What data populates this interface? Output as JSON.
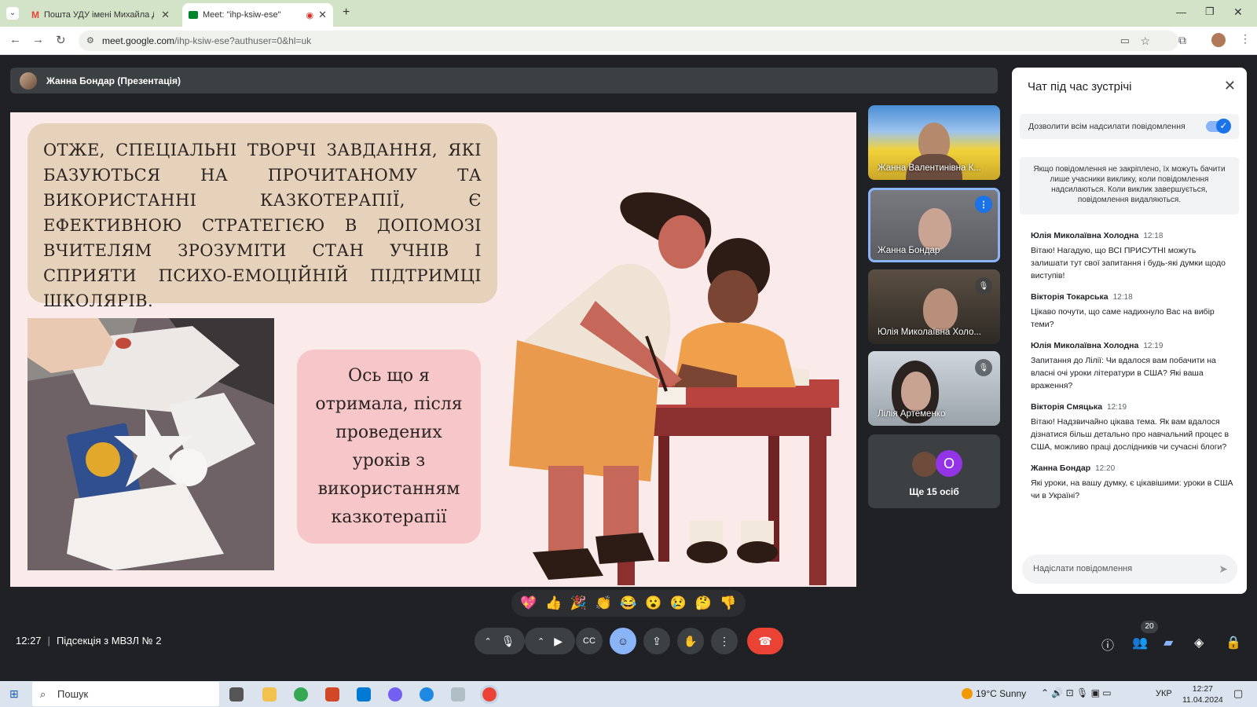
{
  "browser": {
    "tabs": [
      {
        "title": "Пошта УДУ імені Михайла Др",
        "icon": "gmail-icon"
      },
      {
        "title": "Meet: \"ihp-ksiw-ese\"",
        "icon": "meet-icon"
      }
    ],
    "url_host": "meet.google.com",
    "url_path": "/ihp-ksiw-ese?authuser=0&hl=uk"
  },
  "presenter": {
    "label": "Жанна Бондар (Презентація)"
  },
  "slide": {
    "main_text": "Отже, спеціальні творчі завдання, які базуються на прочитаному та використанні казкотерапії, є ефективною стратегією в допомозі вчителям зрозуміти стан учнів і сприяти психо-емоційній підтримці школярів.",
    "pink_text": "Ось що я отримала, після проведених уроків з використанням казкотерапії"
  },
  "tiles": [
    {
      "name": "Жанна Валентинівна К...",
      "state": "normal"
    },
    {
      "name": "Жанна Бондар",
      "state": "speaking"
    },
    {
      "name": "Юлія Миколаївна Холо...",
      "state": "muted"
    },
    {
      "name": "Лілія Артеменко",
      "state": "muted"
    }
  ],
  "more_tile": {
    "avatar_letter": "О",
    "label": "Ще 15 осіб"
  },
  "chat": {
    "title": "Чат під час зустрічі",
    "allow_label": "Дозволити всім надсилати повідомлення",
    "allow_enabled": true,
    "info": "Якщо повідомлення не закріплено, їх можуть бачити лише учасники виклику, коли повідомлення надсилаються. Коли виклик завершується, повідомлення видаляються.",
    "messages": [
      {
        "author": "Юлія Миколаївна Холодна",
        "time": "12:18",
        "text": "Вітаю! Нагадую, що ВСІ ПРИСУТНІ можуть залишати тут свої запитання і будь-які думки щодо виступів!"
      },
      {
        "author": "Вікторія Токарська",
        "time": "12:18",
        "text": "Цікаво почути, що саме надихнуло Вас на вибір теми?"
      },
      {
        "author": "Юлія Миколаївна Холодна",
        "time": "12:19",
        "text": "Запитання до Лілії: Чи вдалося вам побачити на власні очі уроки літератури в США? Які ваша враження?"
      },
      {
        "author": "Вікторія Смяцька",
        "time": "12:19",
        "text": "Вітаю! Надзвичайно цікава тема. Як вам вдалося дізнатися більш детально про навчальний процес в США, можливо праці дослідників чи сучасні блоги?"
      },
      {
        "author": "Жанна Бондар",
        "time": "12:20",
        "text": "Які уроки, на вашу думку, є цікавішими: уроки в США чи в Україні?"
      }
    ],
    "input_placeholder": "Надіслати повідомлення"
  },
  "reactions": [
    "💖",
    "👍",
    "🎉",
    "👏",
    "😂",
    "😮",
    "😢",
    "🤔",
    "👎"
  ],
  "meeting": {
    "time": "12:27",
    "name": "Підсекція з МВЗЛ № 2",
    "participants_count": "20"
  },
  "taskbar": {
    "search_placeholder": "Пошук",
    "weather": "19°C  Sunny",
    "lang": "УКР",
    "time": "12:27",
    "date": "11.04.2024"
  },
  "colors": {
    "accent": "#1a73e8",
    "hangup": "#ea4335",
    "slide_bg": "#fbeaea",
    "text_box": "#e6d1ba",
    "pink_box": "#f6c6c9"
  }
}
